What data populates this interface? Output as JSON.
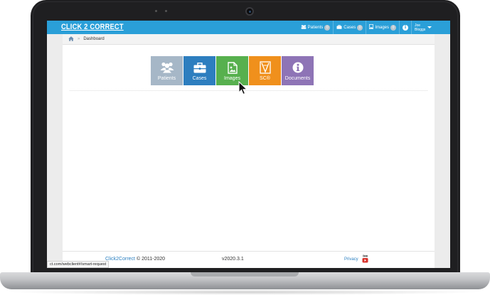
{
  "app": {
    "logo": "CLICK 2 CORRECT"
  },
  "nav": {
    "patients_label": "Patients",
    "patients_count": "0",
    "cases_label": "Cases",
    "cases_count": "0",
    "images_label": "Images",
    "images_count": "0",
    "user_first": "Joe",
    "user_last": "Bloggs"
  },
  "breadcrumb": {
    "current": "Dashboard"
  },
  "tiles": [
    {
      "label": "Patients",
      "icon": "users-icon",
      "color": "#a6b7c7"
    },
    {
      "label": "Cases",
      "icon": "briefcase-icon",
      "color": "#2d7ebf"
    },
    {
      "label": "Images",
      "icon": "image-icon",
      "color": "#57b04e"
    },
    {
      "label": "SC®",
      "icon": "sc-logo-icon",
      "color": "#f0901c"
    },
    {
      "label": "Documents",
      "icon": "info-icon",
      "color": "#8e74b6"
    }
  ],
  "footer": {
    "brand_link": "Click2Correct",
    "copyright": "© 2011-2020",
    "version": "v2020.3.1",
    "privacy": "Privacy"
  },
  "statusbar": {
    "url": "ct.com/webclient#/smart-request"
  },
  "colors": {
    "topbar": "#2a9fd8",
    "accent_link": "#2a7fc0"
  }
}
